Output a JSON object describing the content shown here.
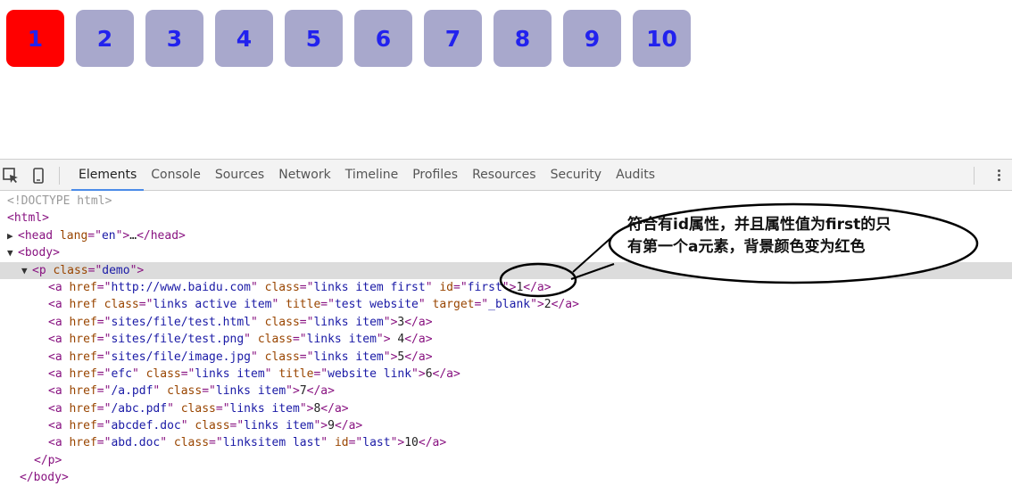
{
  "tiles": [
    {
      "label": "1",
      "active": true
    },
    {
      "label": "2",
      "active": false
    },
    {
      "label": "3",
      "active": false
    },
    {
      "label": "4",
      "active": false
    },
    {
      "label": "5",
      "active": false
    },
    {
      "label": "6",
      "active": false
    },
    {
      "label": "7",
      "active": false
    },
    {
      "label": "8",
      "active": false
    },
    {
      "label": "9",
      "active": false
    },
    {
      "label": "10",
      "active": false
    }
  ],
  "colors": {
    "tile_active": "#ff0000",
    "tile_inactive": "#a8a8cc",
    "tile_text": "#2222ee"
  },
  "devtools": {
    "tabs": [
      "Elements",
      "Console",
      "Sources",
      "Network",
      "Timeline",
      "Profiles",
      "Resources",
      "Security",
      "Audits"
    ],
    "selected_tab": "Elements",
    "tree": {
      "doctype": "<!DOCTYPE html>",
      "html_open": "<html>",
      "head": {
        "tag": "head",
        "attr": "lang",
        "value": "en",
        "ellipsis": "…",
        "close": "</head>"
      },
      "body_open": "<body>",
      "p": {
        "tag": "p",
        "attr": "class",
        "value": "demo"
      },
      "links": [
        {
          "attrs": [
            [
              "href",
              "http://www.baidu.com"
            ],
            [
              "class",
              "links item first"
            ],
            [
              "id",
              "first"
            ]
          ],
          "text": "1"
        },
        {
          "attrs": [
            [
              "href",
              ""
            ],
            [
              "class",
              "links active item"
            ],
            [
              "title",
              "test website"
            ],
            [
              "target",
              "_blank"
            ]
          ],
          "text": "2"
        },
        {
          "attrs": [
            [
              "href",
              "sites/file/test.html"
            ],
            [
              "class",
              "links item"
            ]
          ],
          "text": "3"
        },
        {
          "attrs": [
            [
              "href",
              "sites/file/test.png"
            ],
            [
              "class",
              "links item"
            ]
          ],
          "text": " 4"
        },
        {
          "attrs": [
            [
              "href",
              "sites/file/image.jpg"
            ],
            [
              "class",
              "links item"
            ]
          ],
          "text": "5"
        },
        {
          "attrs": [
            [
              "href",
              "efc"
            ],
            [
              "class",
              "links item"
            ],
            [
              "title",
              "website link"
            ]
          ],
          "text": "6"
        },
        {
          "attrs": [
            [
              "href",
              "/a.pdf"
            ],
            [
              "class",
              "links item"
            ]
          ],
          "text": "7"
        },
        {
          "attrs": [
            [
              "href",
              "/abc.pdf"
            ],
            [
              "class",
              "links item"
            ]
          ],
          "text": "8"
        },
        {
          "attrs": [
            [
              "href",
              "abcdef.doc"
            ],
            [
              "class",
              "links item"
            ]
          ],
          "text": "9"
        },
        {
          "attrs": [
            [
              "href",
              "abd.doc"
            ],
            [
              "class",
              "linksitem last"
            ],
            [
              "id",
              "last"
            ]
          ],
          "text": "10"
        }
      ],
      "p_close": "</p>",
      "body_close": "</body>"
    }
  },
  "annotation": {
    "line1": "符合有id属性，并且属性值为first的只",
    "line2": "有第一个a元素，背景颜色变为红色"
  }
}
